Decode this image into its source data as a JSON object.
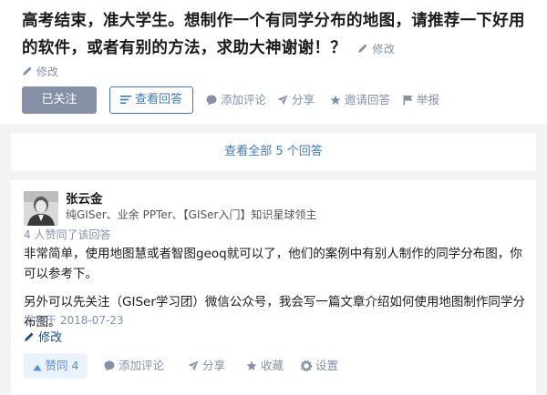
{
  "question": {
    "title": "高考结束，准大学生。想制作一个有同学分布的地图，请推荐一下好用的软件，或者有别的方法，求助大神谢谢！？",
    "title_edit_label": "修改",
    "edit_label": "修改",
    "followed_label": "已关注",
    "view_answers_label": "查看回答",
    "actions": {
      "comment": "添加评论",
      "share": "分享",
      "invite": "邀请回答",
      "report": "举报"
    }
  },
  "view_all_label": "查看全部 5 个回答",
  "answer": {
    "author_name": "张云金",
    "author_bio": "纯GISer、业余 PPTer、【GISer入门】知识星球领主",
    "votes_line": "4 人赞同了该回答",
    "paragraphs": [
      "非常简单，使用地图慧或者智图geoq就可以了，他们的案例中有别人制作的同学分布图，你可以参考下。",
      "另外可以先关注（GISer学习团）微信公众号，我会写一篇文章介绍如何使用地图制作同学分布图。"
    ],
    "published": "发布于 2018-07-23",
    "edit_label": "修改",
    "upvote_label": "赞同 4",
    "actions": {
      "comment": "添加评论",
      "share": "分享",
      "collect": "收藏",
      "settings": "设置"
    }
  },
  "colors": {
    "accent": "#3e7ac2",
    "muted": "#8590a6",
    "followed_bg": "#8590a6",
    "upvote_bg": "#eaf2fc"
  }
}
